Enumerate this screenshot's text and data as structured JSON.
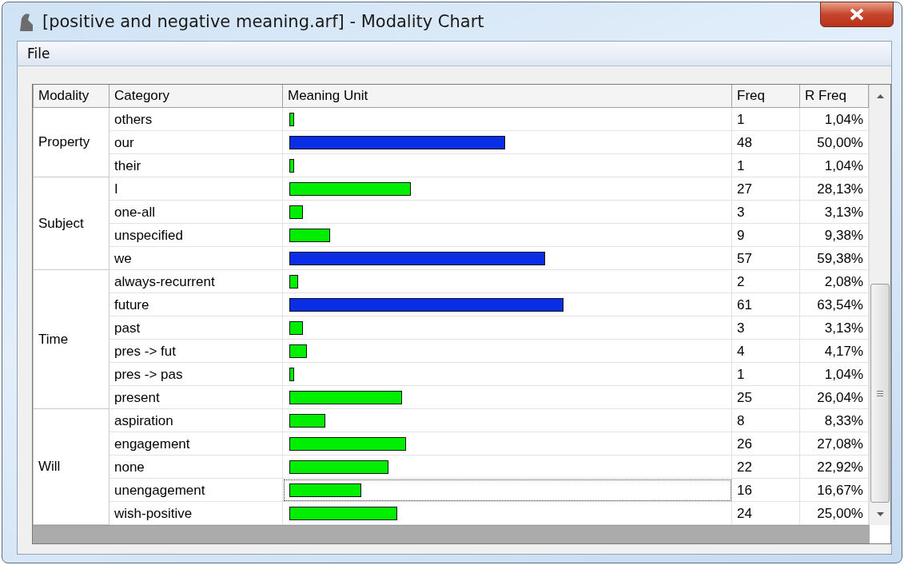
{
  "window": {
    "title": "[positive and negative meaning.arf] - Modality Chart"
  },
  "menu": [
    "File"
  ],
  "table": {
    "columns": [
      "Modality",
      "Category",
      "Meaning Unit",
      "Freq",
      "R Freq"
    ],
    "groups": [
      {
        "modality": "Property",
        "rows": [
          {
            "category": "others",
            "color": "#00ee00",
            "freq": "1",
            "rfreq": "1,04%",
            "selected": false
          },
          {
            "category": "our",
            "color": "#0a2ee6",
            "freq": "48",
            "rfreq": "50,00%",
            "selected": false
          },
          {
            "category": "their",
            "color": "#00ee00",
            "freq": "1",
            "rfreq": "1,04%",
            "selected": false
          }
        ]
      },
      {
        "modality": "Subject",
        "rows": [
          {
            "category": "I",
            "color": "#00ee00",
            "freq": "27",
            "rfreq": "28,13%",
            "selected": false
          },
          {
            "category": "one-all",
            "color": "#00ee00",
            "freq": "3",
            "rfreq": "3,13%",
            "selected": false
          },
          {
            "category": "unspecified",
            "color": "#00ee00",
            "freq": "9",
            "rfreq": "9,38%",
            "selected": false
          },
          {
            "category": "we",
            "color": "#0a2ee6",
            "freq": "57",
            "rfreq": "59,38%",
            "selected": false
          }
        ]
      },
      {
        "modality": "Time",
        "rows": [
          {
            "category": "always-recurrent",
            "color": "#00ee00",
            "freq": "2",
            "rfreq": "2,08%",
            "selected": false
          },
          {
            "category": "future",
            "color": "#0a2ee6",
            "freq": "61",
            "rfreq": "63,54%",
            "selected": false
          },
          {
            "category": "past",
            "color": "#00ee00",
            "freq": "3",
            "rfreq": "3,13%",
            "selected": false
          },
          {
            "category": "pres -> fut",
            "color": "#00ee00",
            "freq": "4",
            "rfreq": "4,17%",
            "selected": false
          },
          {
            "category": "pres -> pas",
            "color": "#00ee00",
            "freq": "1",
            "rfreq": "1,04%",
            "selected": false
          },
          {
            "category": "present",
            "color": "#00ee00",
            "freq": "25",
            "rfreq": "26,04%",
            "selected": false
          }
        ]
      },
      {
        "modality": "Will",
        "rows": [
          {
            "category": "aspiration",
            "color": "#00ee00",
            "freq": "8",
            "rfreq": "8,33%",
            "selected": false
          },
          {
            "category": "engagement",
            "color": "#00ee00",
            "freq": "26",
            "rfreq": "27,08%",
            "selected": false
          },
          {
            "category": "none",
            "color": "#00ee00",
            "freq": "22",
            "rfreq": "22,92%",
            "selected": false
          },
          {
            "category": "unengagement",
            "color": "#00ee00",
            "freq": "16",
            "rfreq": "16,67%",
            "selected": true
          },
          {
            "category": "wish-positive",
            "color": "#00ee00",
            "freq": "24",
            "rfreq": "25,00%",
            "selected": false
          }
        ]
      }
    ]
  }
}
